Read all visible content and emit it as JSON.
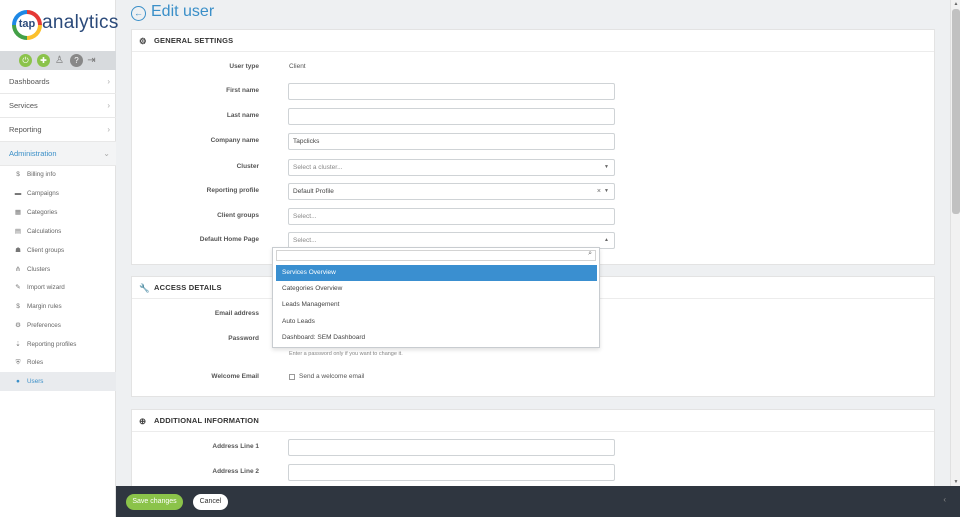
{
  "brand": {
    "logo_mark": "tap",
    "logo_text": "analytics"
  },
  "iconbar": {
    "icons": [
      "power-icon",
      "puzzle-icon",
      "user-icon",
      "help-icon",
      "logout-icon"
    ]
  },
  "nav": {
    "top": [
      {
        "label": "Dashboards"
      },
      {
        "label": "Services"
      },
      {
        "label": "Reporting"
      },
      {
        "label": "Administration"
      }
    ],
    "admin_items": [
      {
        "label": "Billing info",
        "icon": "dollar-icon",
        "glyph": "$"
      },
      {
        "label": "Campaigns",
        "icon": "briefcase-icon",
        "glyph": "▬"
      },
      {
        "label": "Categories",
        "icon": "grid-icon",
        "glyph": "▦"
      },
      {
        "label": "Calculations",
        "icon": "calculator-icon",
        "glyph": "▤"
      },
      {
        "label": "Client groups",
        "icon": "users-icon",
        "glyph": "☗"
      },
      {
        "label": "Clusters",
        "icon": "sitemap-icon",
        "glyph": "⋔"
      },
      {
        "label": "Import wizard",
        "icon": "magic-icon",
        "glyph": "✎"
      },
      {
        "label": "Margin rules",
        "icon": "dollar-icon",
        "glyph": "$"
      },
      {
        "label": "Preferences",
        "icon": "cogs-icon",
        "glyph": "⚙"
      },
      {
        "label": "Reporting profiles",
        "icon": "download-icon",
        "glyph": "⇣"
      },
      {
        "label": "Roles",
        "icon": "shield-icon",
        "glyph": "⛨"
      },
      {
        "label": "Users",
        "icon": "user-icon",
        "glyph": "●"
      }
    ]
  },
  "page": {
    "title": "Edit user"
  },
  "general": {
    "heading": "GENERAL SETTINGS",
    "user_type_label": "User type",
    "user_type_value": "Client",
    "first_name_label": "First name",
    "first_name_value": "",
    "last_name_label": "Last name",
    "last_name_value": "",
    "company_label": "Company name",
    "company_value": "Tapclicks",
    "cluster_label": "Cluster",
    "cluster_placeholder": "Select a cluster...",
    "reporting_profile_label": "Reporting profile",
    "reporting_profile_value": "Default Profile",
    "client_groups_label": "Client groups",
    "client_groups_placeholder": "Select...",
    "home_page_label": "Default Home Page",
    "home_page_placeholder": "Select..."
  },
  "dropdown": {
    "options": [
      "Services Overview",
      "Categories Overview",
      "Leads Management",
      "Auto Leads",
      "Dashboard: SEM Dashboard"
    ],
    "highlighted": "Services Overview"
  },
  "access": {
    "heading": "ACCESS DETAILS",
    "email_label": "Email address",
    "password_label": "Password",
    "password_hint": "Enter a password only if you want to change it.",
    "welcome_label": "Welcome Email",
    "welcome_check": "Send a welcome email"
  },
  "additional": {
    "heading": "ADDITIONAL INFORMATION",
    "address1_label": "Address Line 1",
    "address2_label": "Address Line 2"
  },
  "footer": {
    "save": "Save changes",
    "cancel": "Cancel"
  },
  "colors": {
    "accent": "#3a8fc8",
    "success": "#8bc34a",
    "footer_bg": "#2f3640",
    "highlight": "#3a8fd0"
  }
}
